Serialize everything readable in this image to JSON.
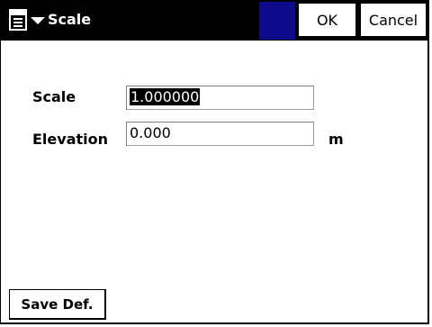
{
  "titlebar": {
    "title": "Scale",
    "menu_icon": "menu-icon",
    "ok_label": "OK",
    "cancel_label": "Cancel",
    "accent_color": "#0a0a8a"
  },
  "form": {
    "scale_label": "Scale",
    "scale_value": "1.000000",
    "elevation_label": "Elevation",
    "elevation_value": "0.000",
    "elevation_unit": "m"
  },
  "footer": {
    "save_default_label": "Save Def."
  }
}
